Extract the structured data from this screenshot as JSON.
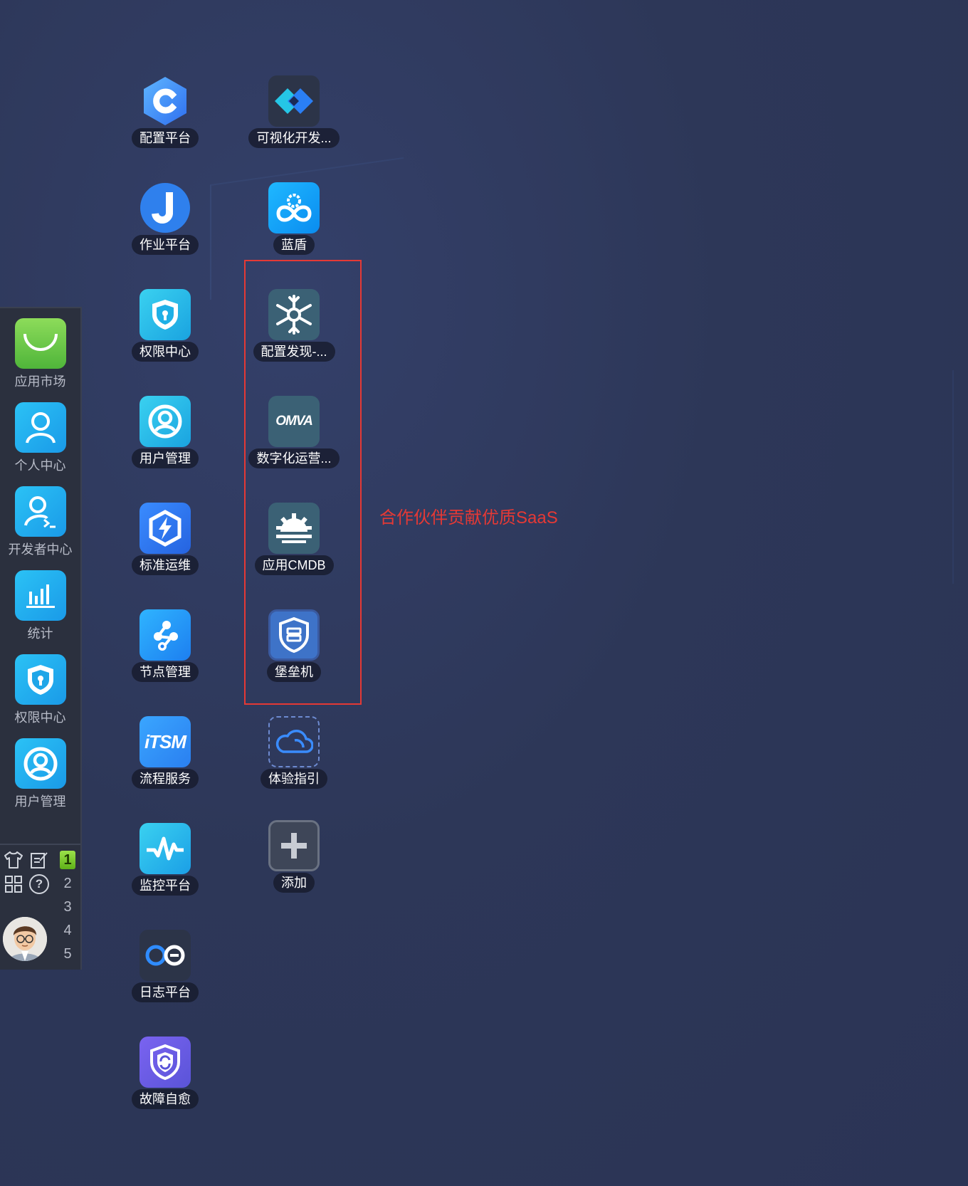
{
  "desktop_apps": [
    {
      "label": "配置平台",
      "icon": "cmdb-c-icon"
    },
    {
      "label": "可视化开发...",
      "icon": "visual-dev-icon"
    },
    {
      "label": "作业平台",
      "icon": "job-j-icon"
    },
    {
      "label": "蓝盾",
      "icon": "bluekind-icon"
    },
    {
      "label": "权限中心",
      "icon": "shield-icon"
    },
    {
      "label": "配置发现-...",
      "icon": "snowflake-icon"
    },
    {
      "label": "用户管理",
      "icon": "user-icon"
    },
    {
      "label": "数字化运营...",
      "icon": "omva-icon"
    },
    {
      "label": "标准运维",
      "icon": "gear-bolt-icon"
    },
    {
      "label": "应用CMDB",
      "icon": "cmdb-gear-icon"
    },
    {
      "label": "节点管理",
      "icon": "node-icon"
    },
    {
      "label": "堡垒机",
      "icon": "bastion-icon"
    },
    {
      "label": "流程服务",
      "icon": "itsm-icon"
    },
    {
      "label": "体验指引",
      "icon": "cloud-icon"
    },
    {
      "label": "监控平台",
      "icon": "monitor-icon"
    },
    {
      "label": "添加",
      "icon": "plus-icon"
    },
    {
      "label": "日志平台",
      "icon": "log-icon"
    },
    {
      "label": "故障自愈",
      "icon": "fault-heal-icon"
    }
  ],
  "itsm_text": "iTSM",
  "omva_text": "OMVA",
  "annotation": "合作伙伴贡献优质SaaS",
  "dock": {
    "apps": [
      {
        "label": "应用市场",
        "icon": "market-icon"
      },
      {
        "label": "个人中心",
        "icon": "person-icon"
      },
      {
        "label": "开发者中心",
        "icon": "developer-icon"
      },
      {
        "label": "统计",
        "icon": "chart-icon"
      },
      {
        "label": "权限中心",
        "icon": "shield-icon"
      },
      {
        "label": "用户管理",
        "icon": "user-icon"
      }
    ],
    "desktops": [
      "1",
      "2",
      "3",
      "4",
      "5"
    ],
    "help_glyph": "?"
  }
}
